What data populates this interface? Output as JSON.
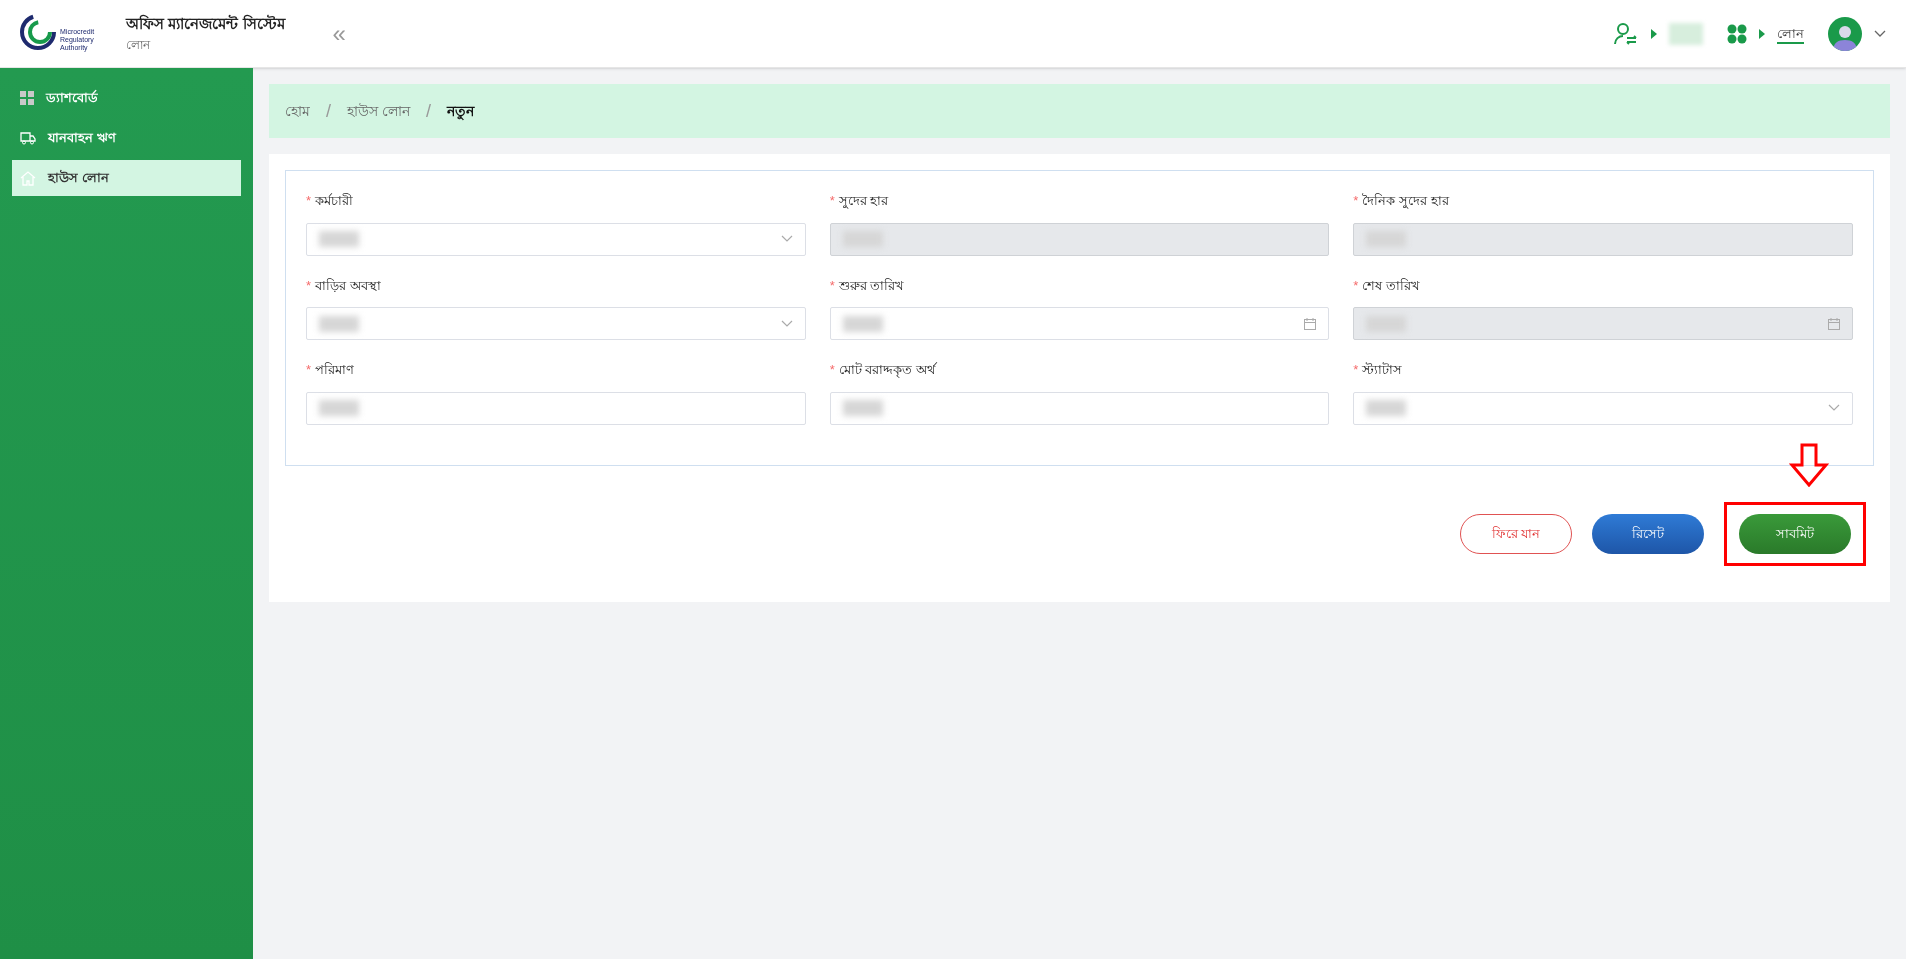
{
  "header": {
    "logo_lines": [
      "Microcredit",
      "Regulatory",
      "Authority"
    ],
    "title": "অফিস ম্যানেজমেন্ট সিস্টেম",
    "subtitle": "লোন",
    "collapse_glyph": "«",
    "module_link": "লোন"
  },
  "sidebar": {
    "items": [
      {
        "label": "ড্যাশবোর্ড",
        "kind": "dashboard",
        "selected": false
      },
      {
        "label": "যানবাহন ঋণ",
        "kind": "vehicle",
        "selected": false
      },
      {
        "label": "হাউস লোন",
        "kind": "house",
        "selected": true
      }
    ]
  },
  "breadcrumb": [
    {
      "label": "হোম",
      "current": false
    },
    {
      "separator": "/",
      "label": "হাউস লোন",
      "current": false
    },
    {
      "separator": "/",
      "label": "নতুন",
      "current": true
    }
  ],
  "form": {
    "fields": [
      {
        "required_mark": "*",
        "label": "কর্মচারী",
        "kind": "select",
        "disabled": false
      },
      {
        "required_mark": "*",
        "label": "সুদের হার",
        "kind": "text",
        "disabled": true
      },
      {
        "required_mark": "*",
        "label": "দৈনিক সুদের হার",
        "kind": "text",
        "disabled": true
      },
      {
        "required_mark": "*",
        "label": "বাড়ির অবস্থা",
        "kind": "select",
        "disabled": false
      },
      {
        "required_mark": "*",
        "label": "শুরুর তারিখ",
        "kind": "date",
        "disabled": false
      },
      {
        "required_mark": "*",
        "label": "শেষ তারিখ",
        "kind": "date",
        "disabled": true
      },
      {
        "required_mark": "*",
        "label": "পরিমাণ",
        "kind": "text",
        "disabled": false
      },
      {
        "required_mark": "*",
        "label": "মোট বরাদ্দকৃত অর্থ",
        "kind": "text",
        "disabled": false
      },
      {
        "required_mark": "*",
        "label": "স্ট্যাটাস",
        "kind": "select",
        "disabled": false
      }
    ]
  },
  "buttons": [
    {
      "label": "ফিরে যান",
      "kind": "back"
    },
    {
      "label": "রিসেট",
      "kind": "reset"
    },
    {
      "label": "সাবমিট",
      "kind": "submit",
      "highlighted": true
    }
  ]
}
